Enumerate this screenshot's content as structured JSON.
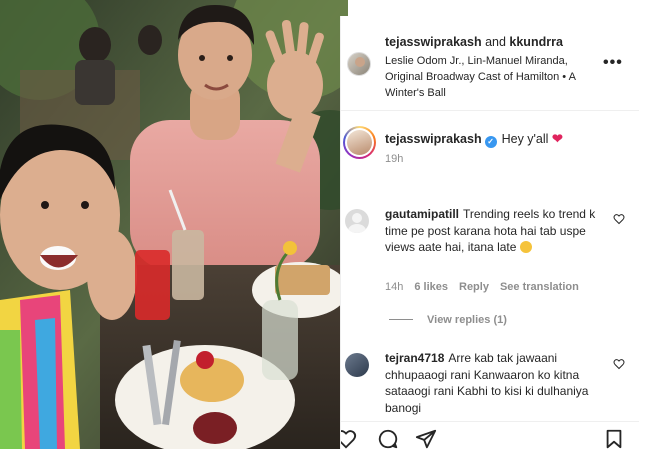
{
  "header": {
    "user1": "tejasswiprakash",
    "joiner": " and ",
    "user2": "kkundrra",
    "audio": "Leslie Odom Jr., Lin-Manuel Miranda, Original Broadway Cast of Hamilton • A Winter's Ball",
    "more": "•••"
  },
  "caption": {
    "username": "tejasswiprakash",
    "text": "Hey y'all",
    "emoji": "❤",
    "time": "19h"
  },
  "comments": [
    {
      "username": "gautamipatill",
      "text": "Trending reels ko trend k time pe post karana hota hai tab uspe views aate hai, itana late",
      "time": "14h",
      "likes": "6 likes",
      "reply": "Reply",
      "translate": "See translation",
      "view_replies": "View replies (1)"
    },
    {
      "username": "tejran4718",
      "text": "Arre kab tak jawaani chhupaaogi rani Kanwaaron ko kitna sataaogi rani Kabhi to kisi ki dulhaniya banogi"
    }
  ],
  "actions": [
    "heart-icon",
    "comment-icon",
    "share-icon",
    "save-icon"
  ],
  "colors": {
    "verified": "#3897f0",
    "heart": "#e0245e",
    "muted": "#8e8e8e"
  }
}
